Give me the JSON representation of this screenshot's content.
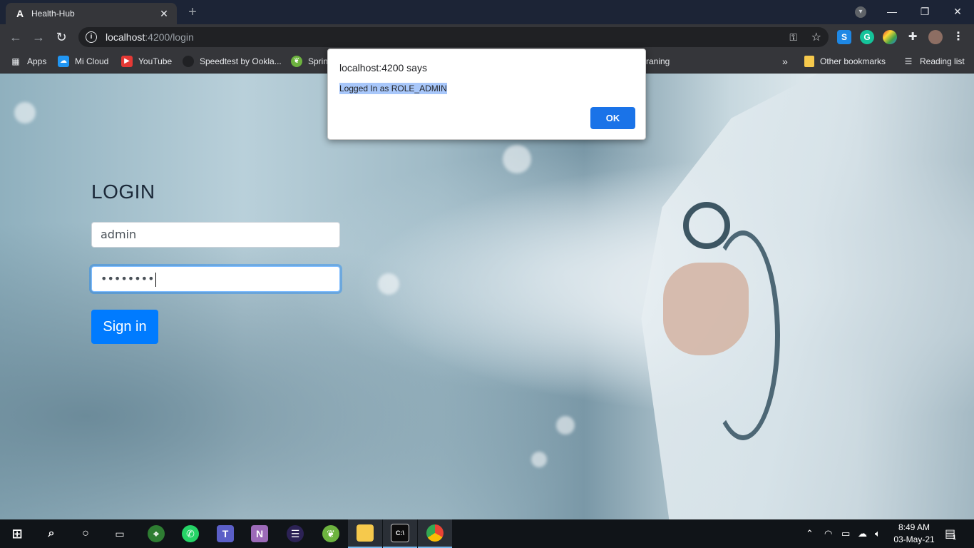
{
  "browser": {
    "tab_title": "Health-Hub",
    "tab_favicon": "A",
    "url_host": "localhost",
    "url_path": ":4200/login",
    "new_tab_glyph": "+",
    "window_controls": {
      "minimize": "—",
      "restore": "❐",
      "close": "✕"
    }
  },
  "bookmarks": [
    {
      "label": "Apps",
      "icon": "apps-grid-icon"
    },
    {
      "label": "Mi Cloud",
      "icon": "mi-cloud-icon"
    },
    {
      "label": "YouTube",
      "icon": "youtube-icon"
    },
    {
      "label": "Speedtest by Ookla...",
      "icon": "speedtest-icon"
    },
    {
      "label": "Sprin",
      "icon": "spring-icon"
    },
    {
      "label": "raning",
      "icon": ""
    },
    {
      "label": "Other bookmarks",
      "icon": "folder-icon"
    },
    {
      "label": "Reading list",
      "icon": "reading-list-icon"
    }
  ],
  "bookmarks_overflow": "»",
  "login": {
    "title": "LOGIN",
    "username_value": "admin",
    "password_masked": "••••••••",
    "signin_label": "Sign in"
  },
  "dialog": {
    "title": "localhost:4200 says",
    "message": "Logged In as ROLE_ADMIN",
    "ok_label": "OK"
  },
  "taskbar": {
    "time": "8:49 AM",
    "date": "03-May-21",
    "notification_count": "1"
  },
  "colors": {
    "primary_button": "#007bff",
    "dialog_ok": "#1a73e8",
    "chrome_dark": "#35363a"
  }
}
